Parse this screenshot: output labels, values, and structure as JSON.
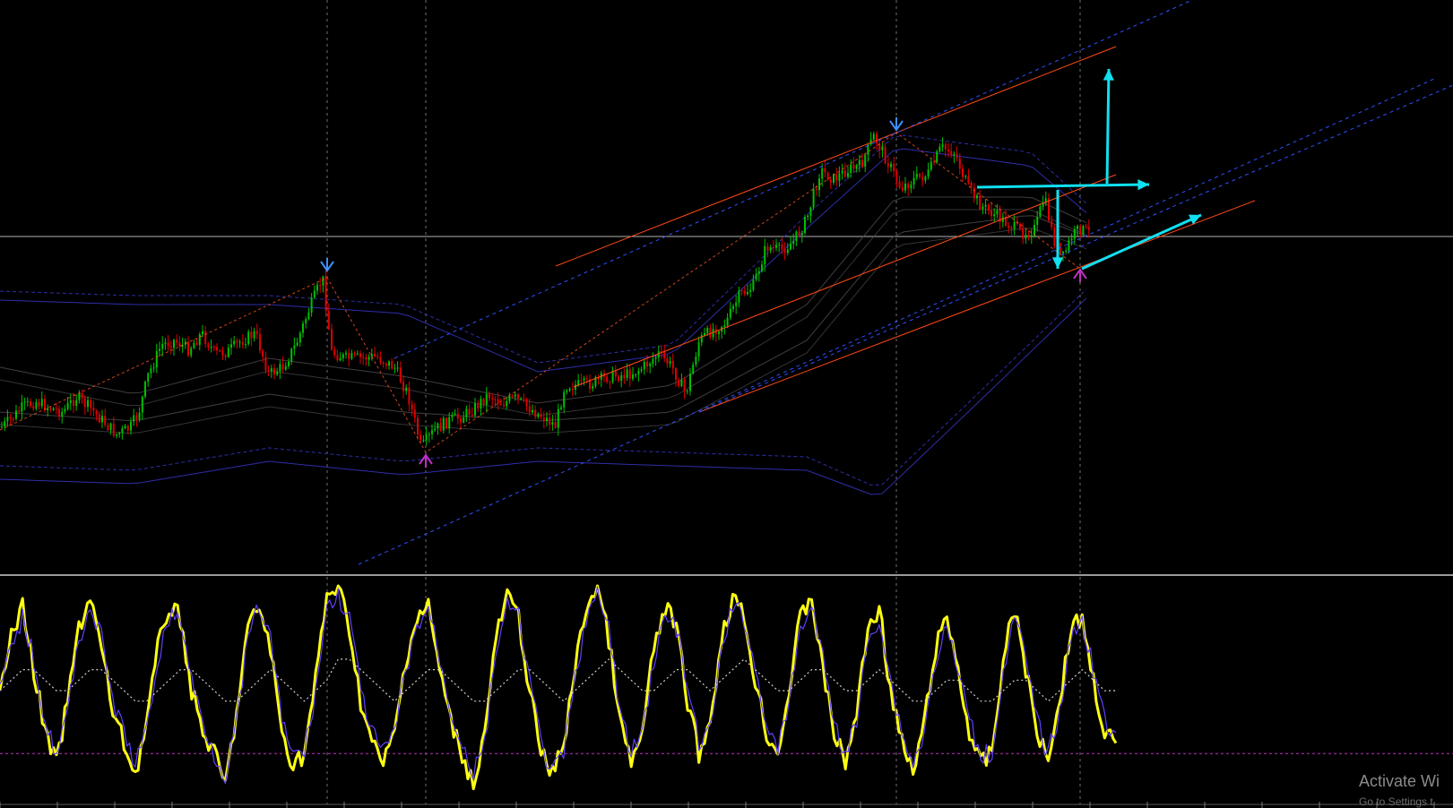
{
  "chart_data": [
    {
      "type": "candlestick",
      "panel": "price",
      "title": "",
      "colors": {
        "up": "#00c000",
        "down": "#e00000",
        "background": "#000000",
        "grid": "#8c8c8c"
      },
      "price_points": [
        [
          0,
          478
        ],
        [
          10,
          470
        ],
        [
          25,
          455
        ],
        [
          40,
          448
        ],
        [
          55,
          455
        ],
        [
          70,
          460
        ],
        [
          85,
          443
        ],
        [
          100,
          455
        ],
        [
          115,
          470
        ],
        [
          130,
          485
        ],
        [
          145,
          478
        ],
        [
          155,
          460
        ],
        [
          165,
          420
        ],
        [
          180,
          385
        ],
        [
          195,
          380
        ],
        [
          210,
          390
        ],
        [
          225,
          372
        ],
        [
          240,
          395
        ],
        [
          255,
          392
        ],
        [
          270,
          380
        ],
        [
          285,
          372
        ],
        [
          300,
          418
        ],
        [
          315,
          410
        ],
        [
          330,
          385
        ],
        [
          345,
          345
        ],
        [
          360,
          310
        ],
        [
          370,
          393
        ],
        [
          385,
          400
        ],
        [
          400,
          400
        ],
        [
          420,
          398
        ],
        [
          440,
          410
        ],
        [
          455,
          440
        ],
        [
          470,
          500
        ],
        [
          485,
          480
        ],
        [
          500,
          470
        ],
        [
          515,
          465
        ],
        [
          530,
          455
        ],
        [
          545,
          440
        ],
        [
          560,
          450
        ],
        [
          575,
          445
        ],
        [
          590,
          455
        ],
        [
          605,
          465
        ],
        [
          620,
          475
        ],
        [
          630,
          430
        ],
        [
          645,
          430
        ],
        [
          660,
          428
        ],
        [
          680,
          420
        ],
        [
          700,
          418
        ],
        [
          715,
          412
        ],
        [
          735,
          395
        ],
        [
          750,
          410
        ],
        [
          765,
          440
        ],
        [
          780,
          380
        ],
        [
          795,
          368
        ],
        [
          810,
          360
        ],
        [
          825,
          330
        ],
        [
          840,
          320
        ],
        [
          855,
          275
        ],
        [
          870,
          280
        ],
        [
          885,
          270
        ],
        [
          900,
          245
        ],
        [
          915,
          190
        ],
        [
          930,
          200
        ],
        [
          945,
          190
        ],
        [
          960,
          185
        ],
        [
          975,
          152
        ],
        [
          990,
          180
        ],
        [
          1005,
          210
        ],
        [
          1020,
          200
        ],
        [
          1035,
          195
        ],
        [
          1050,
          165
        ],
        [
          1065,
          170
        ],
        [
          1080,
          210
        ],
        [
          1095,
          230
        ],
        [
          1110,
          240
        ],
        [
          1125,
          250
        ],
        [
          1140,
          260
        ],
        [
          1155,
          255
        ],
        [
          1165,
          220
        ],
        [
          1175,
          265
        ],
        [
          1185,
          290
        ],
        [
          1195,
          265
        ],
        [
          1205,
          255
        ],
        [
          1215,
          260
        ]
      ],
      "indicators": [
        {
          "name": "",
          "kind": "bollinger",
          "color": "#3636c8",
          "dashed": true,
          "points": [
            [
              0,
              325
            ],
            [
              150,
              330
            ],
            [
              300,
              330
            ],
            [
              450,
              340
            ],
            [
              600,
              405
            ],
            [
              750,
              385
            ],
            [
              900,
              240
            ],
            [
              1000,
              150
            ],
            [
              1150,
              170
            ],
            [
              1215,
              230
            ]
          ]
        },
        {
          "name": "",
          "kind": "bollinger",
          "color": "#3636c8",
          "dashed": false,
          "points": [
            [
              0,
              335
            ],
            [
              150,
              340
            ],
            [
              300,
              340
            ],
            [
              450,
              350
            ],
            [
              600,
              415
            ],
            [
              750,
              395
            ],
            [
              900,
              255
            ],
            [
              1000,
              165
            ],
            [
              1150,
              185
            ],
            [
              1215,
              240
            ]
          ]
        },
        {
          "name": "",
          "kind": "bollinger",
          "color": "#3636c8",
          "dashed": true,
          "points": [
            [
              0,
              520
            ],
            [
              150,
              525
            ],
            [
              300,
              500
            ],
            [
              450,
              515
            ],
            [
              600,
              500
            ],
            [
              750,
              505
            ],
            [
              900,
              510
            ],
            [
              980,
              545
            ],
            [
              1080,
              450
            ],
            [
              1215,
              320
            ]
          ]
        },
        {
          "name": "",
          "kind": "bollinger",
          "color": "#3636c8",
          "dashed": false,
          "points": [
            [
              0,
              535
            ],
            [
              150,
              540
            ],
            [
              300,
              515
            ],
            [
              450,
              530
            ],
            [
              600,
              515
            ],
            [
              750,
              520
            ],
            [
              900,
              525
            ],
            [
              980,
              555
            ],
            [
              1080,
              460
            ],
            [
              1215,
              330
            ]
          ]
        },
        {
          "name": "",
          "kind": "ma",
          "color": "#4a4a4a",
          "dashed": false,
          "points": [
            [
              0,
              410
            ],
            [
              150,
              440
            ],
            [
              300,
              400
            ],
            [
              450,
              420
            ],
            [
              600,
              450
            ],
            [
              750,
              430
            ],
            [
              900,
              340
            ],
            [
              1000,
              220
            ],
            [
              1150,
              220
            ],
            [
              1215,
              250
            ]
          ]
        },
        {
          "name": "",
          "kind": "ma",
          "color": "#4a4a4a",
          "dashed": false,
          "points": [
            [
              0,
              460
            ],
            [
              150,
              470
            ],
            [
              300,
              440
            ],
            [
              450,
              460
            ],
            [
              600,
              470
            ],
            [
              750,
              460
            ],
            [
              900,
              380
            ],
            [
              1000,
              260
            ],
            [
              1150,
              240
            ],
            [
              1215,
              265
            ]
          ]
        }
      ],
      "trend_lines": [
        {
          "color": "#ff4a14",
          "dashed": false,
          "from": [
            620,
            297
          ],
          "to": [
            1245,
            52
          ]
        },
        {
          "color": "#ff4a14",
          "dashed": false,
          "from": [
            640,
            432
          ],
          "to": [
            1245,
            195
          ]
        },
        {
          "color": "#ff4a14",
          "dashed": false,
          "from": [
            780,
            460
          ],
          "to": [
            1400,
            224
          ]
        },
        {
          "color": "#3050ff",
          "dashed": true,
          "from": [
            400,
            630
          ],
          "to": [
            1600,
            88
          ]
        },
        {
          "color": "#3050ff",
          "dashed": true,
          "from": [
            440,
            400
          ],
          "to": [
            1330,
            0
          ]
        },
        {
          "color": "#3050ff",
          "dashed": true,
          "from": [
            780,
            460
          ],
          "to": [
            1621,
            95
          ]
        }
      ],
      "zigzag": [
        [
          0,
          480
        ],
        [
          365,
          310
        ],
        [
          475,
          505
        ],
        [
          1000,
          148
        ],
        [
          1205,
          300
        ]
      ],
      "signals": [
        {
          "kind": "down-arrow",
          "color": "#3f8fff",
          "at": [
            365,
            300
          ]
        },
        {
          "kind": "down-arrow",
          "color": "#3f8fff",
          "at": [
            1000,
            143
          ]
        },
        {
          "kind": "up-arrow",
          "color": "#c030c0",
          "at": [
            475,
            510
          ]
        },
        {
          "kind": "up-arrow",
          "color": "#c030c0",
          "at": [
            1205,
            303
          ]
        }
      ],
      "annotations": [
        {
          "kind": "arrow",
          "color": "#10e0f0",
          "from": [
            1235,
            205
          ],
          "to": [
            1237,
            77
          ]
        },
        {
          "kind": "arrow",
          "color": "#10e0f0",
          "from": [
            1090,
            209
          ],
          "to": [
            1282,
            206
          ]
        },
        {
          "kind": "arrow",
          "color": "#10e0f0",
          "from": [
            1180,
            212
          ],
          "to": [
            1180,
            300
          ]
        },
        {
          "kind": "arrow",
          "color": "#10e0f0",
          "from": [
            1207,
            300
          ],
          "to": [
            1340,
            240
          ]
        }
      ],
      "horizontal_lines": [
        {
          "color": "#b4b4b4",
          "y": 264
        }
      ],
      "vertical_lines": [
        {
          "color": "#8c8c8c",
          "dashed": true,
          "x": [
            365,
            475,
            1000,
            1205
          ]
        }
      ],
      "grid": false
    },
    {
      "type": "line",
      "panel": "oscillator",
      "title": "",
      "levels": [
        {
          "y": 0.2,
          "color": "#c030c0",
          "dashed": true
        }
      ],
      "series": [
        {
          "name": "",
          "color": "#ffff10",
          "values": [
            0.55,
            0.75,
            0.9,
            0.6,
            0.3,
            0.15,
            0.45,
            0.8,
            0.95,
            0.7,
            0.4,
            0.25,
            0.1,
            0.35,
            0.7,
            0.9,
            0.85,
            0.5,
            0.3,
            0.2,
            0.05,
            0.4,
            0.8,
            0.9,
            0.7,
            0.3,
            0.15,
            0.2,
            0.55,
            0.95,
            1.0,
            0.8,
            0.45,
            0.25,
            0.15,
            0.3,
            0.65,
            0.85,
            0.9,
            0.6,
            0.35,
            0.2,
            0.05,
            0.3,
            0.75,
            0.95,
            0.85,
            0.5,
            0.2,
            0.1,
            0.25,
            0.6,
            0.9,
            1.0,
            0.75,
            0.35,
            0.15,
            0.3,
            0.7,
            0.9,
            0.8,
            0.45,
            0.2,
            0.35,
            0.75,
            0.95,
            0.85,
            0.55,
            0.3,
            0.2,
            0.5,
            0.85,
            0.95,
            0.6,
            0.3,
            0.15,
            0.4,
            0.8,
            0.9,
            0.5,
            0.25,
            0.1,
            0.35,
            0.7,
            0.85,
            0.6,
            0.3,
            0.15,
            0.2,
            0.65,
            0.9,
            0.6,
            0.3,
            0.2,
            0.45,
            0.8,
            0.85,
            0.55,
            0.3,
            0.25
          ]
        },
        {
          "name": "",
          "color": "#6040ff",
          "values": [
            0.5,
            0.7,
            0.85,
            0.65,
            0.35,
            0.2,
            0.4,
            0.75,
            0.9,
            0.75,
            0.45,
            0.3,
            0.15,
            0.3,
            0.65,
            0.85,
            0.85,
            0.55,
            0.35,
            0.2,
            0.1,
            0.35,
            0.75,
            0.9,
            0.75,
            0.35,
            0.2,
            0.2,
            0.5,
            0.9,
            0.95,
            0.85,
            0.5,
            0.3,
            0.2,
            0.3,
            0.6,
            0.8,
            0.9,
            0.65,
            0.4,
            0.25,
            0.1,
            0.25,
            0.7,
            0.9,
            0.85,
            0.55,
            0.25,
            0.1,
            0.2,
            0.55,
            0.85,
            0.95,
            0.8,
            0.4,
            0.2,
            0.3,
            0.65,
            0.85,
            0.8,
            0.5,
            0.25,
            0.3,
            0.7,
            0.9,
            0.85,
            0.6,
            0.35,
            0.2,
            0.45,
            0.8,
            0.9,
            0.65,
            0.35,
            0.2,
            0.35,
            0.75,
            0.85,
            0.55,
            0.3,
            0.15,
            0.3,
            0.65,
            0.8,
            0.6,
            0.35,
            0.2,
            0.2,
            0.6,
            0.85,
            0.65,
            0.35,
            0.2,
            0.4,
            0.75,
            0.85,
            0.6,
            0.35,
            0.3
          ]
        },
        {
          "name": "",
          "color": "#d0d0d0",
          "dashed": true,
          "values": [
            0.5,
            0.55,
            0.6,
            0.6,
            0.55,
            0.5,
            0.5,
            0.55,
            0.6,
            0.6,
            0.55,
            0.5,
            0.45,
            0.45,
            0.5,
            0.55,
            0.6,
            0.6,
            0.55,
            0.5,
            0.45,
            0.45,
            0.5,
            0.55,
            0.6,
            0.55,
            0.5,
            0.45,
            0.5,
            0.55,
            0.65,
            0.65,
            0.6,
            0.55,
            0.5,
            0.45,
            0.5,
            0.55,
            0.6,
            0.6,
            0.55,
            0.5,
            0.45,
            0.45,
            0.5,
            0.55,
            0.6,
            0.6,
            0.55,
            0.5,
            0.45,
            0.5,
            0.55,
            0.6,
            0.65,
            0.6,
            0.55,
            0.5,
            0.5,
            0.55,
            0.6,
            0.6,
            0.55,
            0.5,
            0.55,
            0.6,
            0.65,
            0.6,
            0.55,
            0.5,
            0.5,
            0.55,
            0.6,
            0.6,
            0.55,
            0.5,
            0.5,
            0.55,
            0.6,
            0.55,
            0.5,
            0.45,
            0.45,
            0.5,
            0.55,
            0.55,
            0.5,
            0.45,
            0.45,
            0.5,
            0.55,
            0.55,
            0.5,
            0.45,
            0.5,
            0.55,
            0.6,
            0.55,
            0.5,
            0.5
          ]
        }
      ],
      "grid": false
    }
  ],
  "overlay": {
    "watermark_title": "Activate Wi",
    "watermark_sub": "Go to Settings t"
  }
}
